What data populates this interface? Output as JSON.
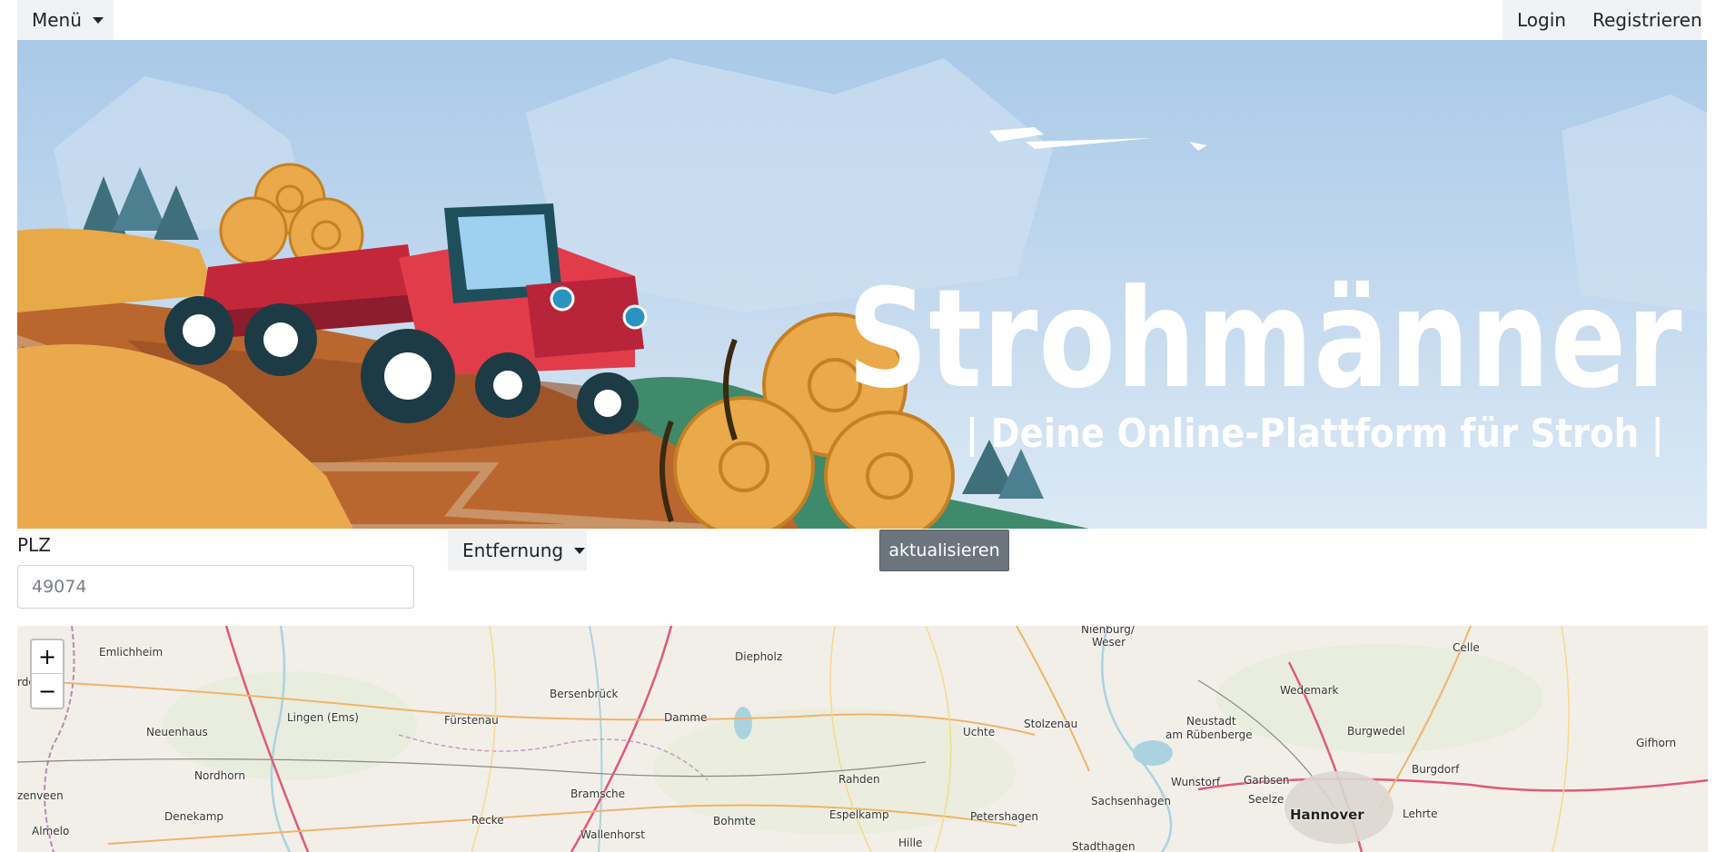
{
  "nav": {
    "menu_label": "Menü",
    "login_label": "Login",
    "register_label": "Registrieren"
  },
  "hero": {
    "title": "Strohmänner",
    "subtitle": "| Deine Online-Plattform für Stroh |"
  },
  "form": {
    "plz_label": "PLZ",
    "plz_placeholder": "49074",
    "distance_label": "Entfernung",
    "update_label": "aktualisieren"
  },
  "map": {
    "zoom_in": "+",
    "zoom_out": "−",
    "places": [
      {
        "name": "Emlichheim"
      },
      {
        "name": "Neuenhaus"
      },
      {
        "name": "Nordhorn"
      },
      {
        "name": "Denekamp"
      },
      {
        "name": "Almelo"
      },
      {
        "name": "zenveen"
      },
      {
        "name": "rde"
      },
      {
        "name": "Lingen (Ems)"
      },
      {
        "name": "Fürstenau"
      },
      {
        "name": "Bersenbrück"
      },
      {
        "name": "Diepholz"
      },
      {
        "name": "Damme"
      },
      {
        "name": "Bramsche"
      },
      {
        "name": "Recke"
      },
      {
        "name": "Wallenhorst"
      },
      {
        "name": "Bohmte"
      },
      {
        "name": "Rahden"
      },
      {
        "name": "Espelkamp"
      },
      {
        "name": "Petershagen"
      },
      {
        "name": "Hille"
      },
      {
        "name": "Uchte"
      },
      {
        "name": "Stolzenau"
      },
      {
        "name": "Nienburg/"
      },
      {
        "name": "Weser"
      },
      {
        "name": "Neustadt"
      },
      {
        "name": "am Rübenberge"
      },
      {
        "name": "Wunstorf"
      },
      {
        "name": "Garbsen"
      },
      {
        "name": "Seelze"
      },
      {
        "name": "Sachsenhagen"
      },
      {
        "name": "Stadthagen"
      },
      {
        "name": "Hannover"
      },
      {
        "name": "Lehrte"
      },
      {
        "name": "Wedemark"
      },
      {
        "name": "Burgwedel"
      },
      {
        "name": "Burgdorf"
      },
      {
        "name": "Celle"
      },
      {
        "name": "Gifhorn"
      }
    ]
  }
}
